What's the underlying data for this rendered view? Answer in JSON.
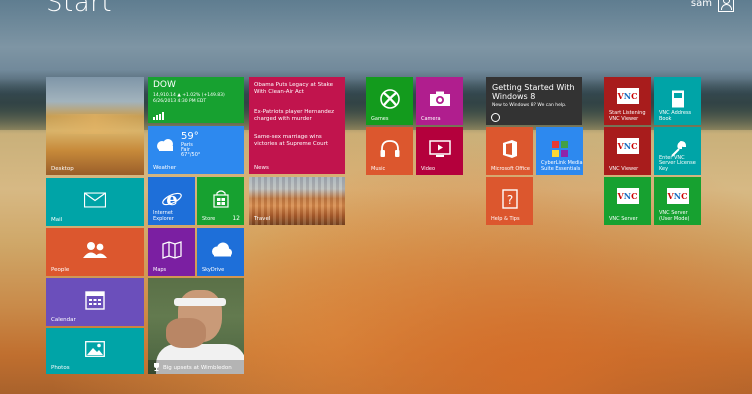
{
  "screen": {
    "title": "Start"
  },
  "user": {
    "name": "sam",
    "avatar_icon": "person-icon"
  },
  "tiles": {
    "desktop": {
      "label": "Desktop"
    },
    "mail": {
      "label": "Mail",
      "icon": "envelope-icon"
    },
    "people": {
      "label": "People",
      "icon": "people-icon"
    },
    "calendar": {
      "label": "Calendar",
      "icon": "calendar-icon"
    },
    "photos": {
      "label": "Photos",
      "icon": "photo-icon"
    },
    "finance": {
      "title": "DOW",
      "line1": "14,910.14  ▲ +1.02% (+149.83)",
      "line2": "6/26/2013 4:30 PM EDT"
    },
    "weather": {
      "temp": "59°",
      "city": "Paris",
      "condition": "Fair",
      "range": "67°/50°",
      "label": "Weather"
    },
    "ie": {
      "label": "Internet Explorer"
    },
    "store": {
      "label": "Store",
      "badge": "12"
    },
    "maps": {
      "label": "Maps"
    },
    "skydrive": {
      "label": "SkyDrive"
    },
    "sports": {
      "label": "Big upsets at Wimbledon"
    },
    "news": {
      "headline1": "Obama Puts Legacy at Stake With Clean-Air Act",
      "headline2": "Ex-Patriots player Hernandez charged with murder",
      "headline3": "Same-sex marriage wins victories at Supreme Court",
      "label": "News"
    },
    "travel": {
      "label": "Travel"
    },
    "games": {
      "label": "Games"
    },
    "camera": {
      "label": "Camera"
    },
    "music": {
      "label": "Music"
    },
    "video": {
      "label": "Video"
    },
    "getting_started": {
      "title": "Getting Started With Windows 8",
      "subtitle": "New to Windows 8? We can help."
    },
    "office": {
      "label": "Microsoft Office"
    },
    "cyberlink": {
      "label": "CyberLink Media Suite Essentials"
    },
    "help": {
      "label": "Help & Tips"
    },
    "vnc_listening": {
      "label": "Start Listening VNC Viewer"
    },
    "vnc_address_book": {
      "label": "VNC Address Book"
    },
    "vnc_viewer": {
      "label": "VNC Viewer"
    },
    "vnc_license": {
      "label": "Enter VNC Server License Key"
    },
    "vnc_server": {
      "label": "VNC Server"
    },
    "vnc_server_user": {
      "label": "VNC Server (User Mode)"
    }
  },
  "colors": {
    "teal": "#00a4a7",
    "green": "#17a130",
    "blue": "#2d89ef",
    "purple": "#7b1fa2",
    "orange": "#dc572e",
    "news_red": "#c1144d",
    "vnc_red": "#a81c1c",
    "dark": "#333333"
  }
}
